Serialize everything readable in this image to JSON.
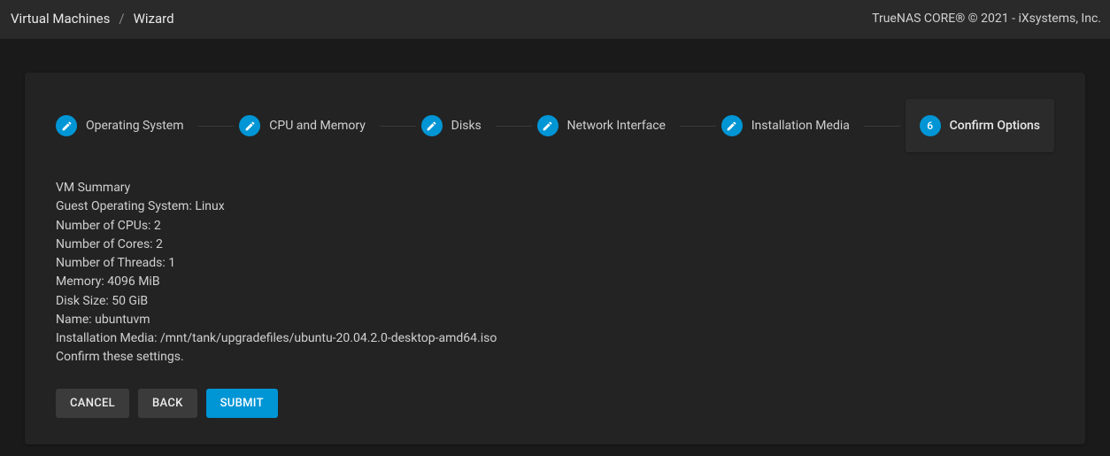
{
  "breadcrumb": {
    "root": "Virtual Machines",
    "current": "Wizard"
  },
  "branding": "TrueNAS CORE® © 2021 - iXsystems, Inc.",
  "steps": [
    {
      "label": "Operating System",
      "state": "done"
    },
    {
      "label": "CPU and Memory",
      "state": "done"
    },
    {
      "label": "Disks",
      "state": "done"
    },
    {
      "label": "Network Interface",
      "state": "done"
    },
    {
      "label": "Installation Media",
      "state": "done"
    },
    {
      "label": "Confirm Options",
      "state": "current",
      "num": "6"
    }
  ],
  "summary": {
    "title": "VM Summary",
    "lines": [
      "Guest Operating System: Linux",
      "Number of CPUs: 2",
      "Number of Cores: 2",
      "Number of Threads: 1",
      "Memory: 4096 MiB",
      "Disk Size: 50 GiB",
      "Name: ubuntuvm",
      "Installation Media: /mnt/tank/upgradefiles/ubuntu-20.04.2.0-desktop-amd64.iso"
    ],
    "confirm_text": "Confirm these settings."
  },
  "actions": {
    "cancel": "CANCEL",
    "back": "BACK",
    "submit": "SUBMIT"
  }
}
